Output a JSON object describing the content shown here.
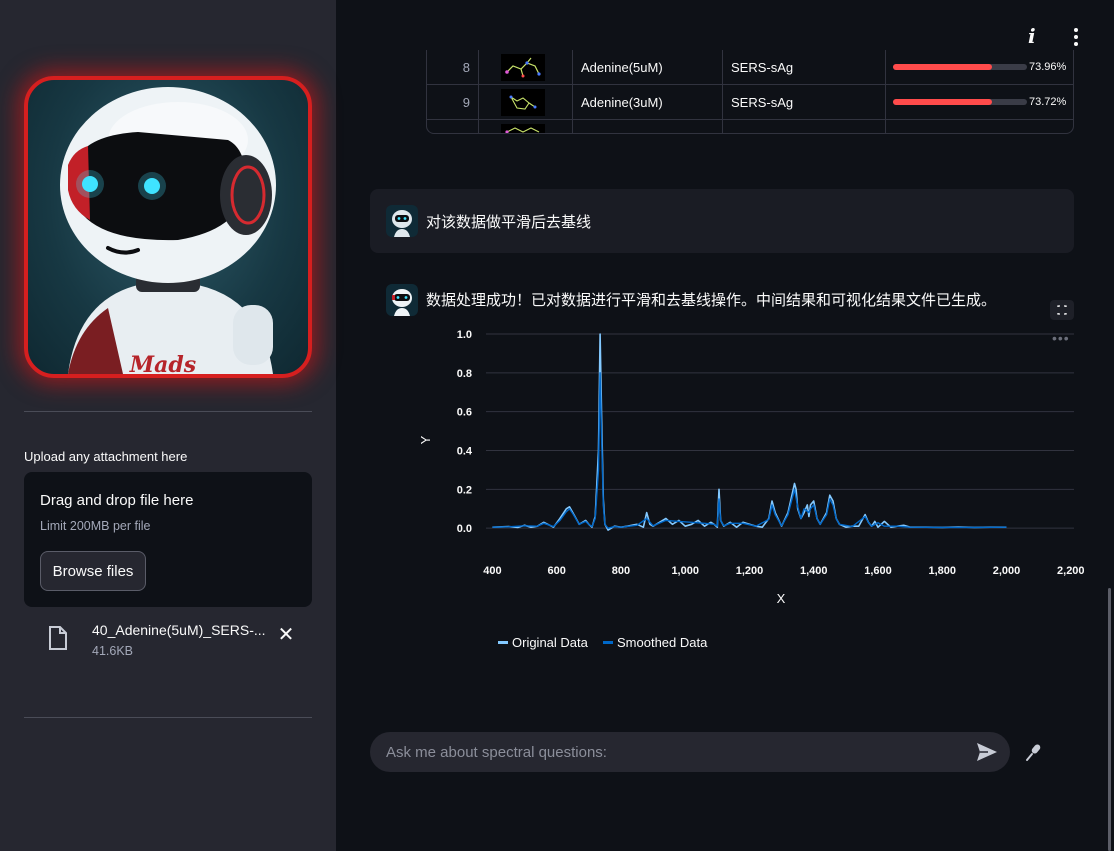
{
  "sidebar": {
    "avatar_text": "Mads",
    "upload_label": "Upload any attachment here",
    "dropzone": {
      "title": "Drag and drop file here",
      "limit": "Limit 200MB per file",
      "browse_label": "Browse files"
    },
    "file": {
      "name": "40_Adenine(5uM)_SERS-...",
      "size": "41.6KB"
    }
  },
  "header": {
    "info_icon": "i",
    "menu_icon": "more-vertical-icon"
  },
  "table": {
    "rows": [
      {
        "index": "8",
        "name": "Adenine(5uM)",
        "type": "SERS-sAg",
        "score": "73.96%",
        "score_value": 0.7396
      },
      {
        "index": "9",
        "name": "Adenine(3uM)",
        "type": "SERS-sAg",
        "score": "73.72%",
        "score_value": 0.7372
      }
    ]
  },
  "chat": {
    "user_message": "对该数据做平滑后去基线",
    "assistant_message": "数据处理成功！已对数据进行平滑和去基线操作。中间结果和可视化结果文件已生成。",
    "input_placeholder": "Ask me about spectral questions:"
  },
  "colors": {
    "accent": "#ff4b4b",
    "original": "#83c9ff",
    "smoothed": "#0068c9"
  },
  "chart_data": {
    "type": "line",
    "xlabel": "X",
    "ylabel": "Y",
    "xlim": [
      380,
      2210
    ],
    "ylim": [
      -0.03,
      1.0
    ],
    "x_ticks": [
      400,
      600,
      800,
      1000,
      1200,
      1400,
      1600,
      1800,
      2000,
      2200
    ],
    "x_tick_labels": [
      "400",
      "600",
      "800",
      "1,000",
      "1,200",
      "1,400",
      "1,600",
      "1,800",
      "2,000",
      "2,200"
    ],
    "y_ticks": [
      0,
      0.2,
      0.4,
      0.6,
      0.8,
      1.0
    ],
    "y_tick_labels": [
      "0.0",
      "0.2",
      "0.4",
      "0.6",
      "0.8",
      "1.0"
    ],
    "grid": true,
    "legend_position": "bottom",
    "series": [
      {
        "name": "Original Data",
        "color": "#83c9ff",
        "x": [
          400,
          450,
          480,
          500,
          520,
          540,
          560,
          590,
          610,
          630,
          640,
          650,
          670,
          690,
          700,
          710,
          720,
          730,
          735,
          740,
          745,
          750,
          760,
          780,
          800,
          820,
          850,
          870,
          880,
          890,
          900,
          920,
          940,
          960,
          980,
          1000,
          1020,
          1040,
          1060,
          1080,
          1090,
          1100,
          1105,
          1110,
          1120,
          1140,
          1160,
          1180,
          1200,
          1220,
          1240,
          1260,
          1270,
          1280,
          1300,
          1320,
          1340,
          1345,
          1350,
          1360,
          1370,
          1380,
          1385,
          1390,
          1400,
          1410,
          1420,
          1440,
          1450,
          1460,
          1470,
          1480,
          1500,
          1520,
          1540,
          1560,
          1570,
          1580,
          1590,
          1600,
          1620,
          1640,
          1660,
          1680,
          1700,
          1750,
          1800,
          1850,
          1900,
          1950,
          2000
        ],
        "y": [
          0.005,
          0.008,
          0.004,
          0.015,
          0.005,
          0.01,
          0.03,
          0.005,
          0.05,
          0.1,
          0.11,
          0.08,
          0.02,
          0.04,
          0.02,
          0.005,
          0.06,
          0.4,
          1.0,
          0.55,
          0.15,
          0.02,
          -0.01,
          0.01,
          0.005,
          0.01,
          0.02,
          0.005,
          0.08,
          0.02,
          0.01,
          0.03,
          0.05,
          0.02,
          0.04,
          0.01,
          0.02,
          0.04,
          0.01,
          0.03,
          0.02,
          0.005,
          0.2,
          0.04,
          0.01,
          0.03,
          0.005,
          0.03,
          0.02,
          0.01,
          0.005,
          0.05,
          0.14,
          0.08,
          0.01,
          0.08,
          0.23,
          0.2,
          0.1,
          0.05,
          0.08,
          0.12,
          0.06,
          0.12,
          0.14,
          0.05,
          0.02,
          0.08,
          0.17,
          0.14,
          0.05,
          0.02,
          0.005,
          0.01,
          0.01,
          0.07,
          0.03,
          0.01,
          0.035,
          0.005,
          0.035,
          0.005,
          0.01,
          0.015,
          0.005,
          0.005,
          0.004,
          0.006,
          0.004,
          0.005,
          0.005
        ]
      },
      {
        "name": "Smoothed Data",
        "color": "#0068c9",
        "x": [
          400,
          450,
          500,
          540,
          560,
          590,
          610,
          630,
          640,
          650,
          670,
          690,
          700,
          710,
          720,
          730,
          735,
          740,
          745,
          750,
          760,
          780,
          800,
          850,
          880,
          900,
          940,
          980,
          1020,
          1060,
          1090,
          1100,
          1105,
          1110,
          1120,
          1140,
          1180,
          1220,
          1260,
          1270,
          1280,
          1300,
          1320,
          1340,
          1350,
          1360,
          1370,
          1385,
          1390,
          1400,
          1410,
          1420,
          1440,
          1450,
          1460,
          1470,
          1480,
          1520,
          1560,
          1570,
          1580,
          1600,
          1620,
          1660,
          1700,
          1800,
          1900,
          2000
        ],
        "y": [
          0.005,
          0.007,
          0.012,
          0.01,
          0.025,
          0.008,
          0.04,
          0.085,
          0.1,
          0.075,
          0.02,
          0.035,
          0.02,
          0.008,
          0.05,
          0.3,
          0.8,
          0.45,
          0.12,
          0.02,
          0.0,
          0.008,
          0.005,
          0.015,
          0.05,
          0.012,
          0.04,
          0.035,
          0.03,
          0.025,
          0.02,
          0.01,
          0.15,
          0.04,
          0.012,
          0.025,
          0.025,
          0.01,
          0.045,
          0.12,
          0.07,
          0.012,
          0.07,
          0.2,
          0.11,
          0.05,
          0.1,
          0.08,
          0.1,
          0.12,
          0.05,
          0.02,
          0.07,
          0.15,
          0.12,
          0.05,
          0.02,
          0.008,
          0.06,
          0.03,
          0.01,
          0.028,
          0.01,
          0.01,
          0.005,
          0.004,
          0.004,
          0.005
        ]
      }
    ]
  }
}
